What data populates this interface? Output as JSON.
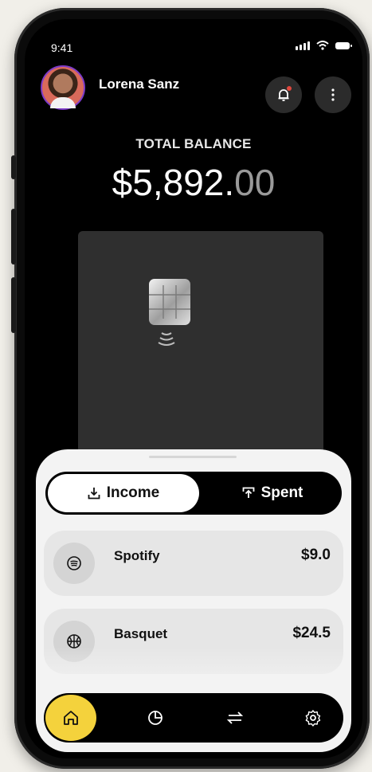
{
  "status_bar": {
    "time": "9:41"
  },
  "header": {
    "user_name": "Lorena Sanz"
  },
  "balance": {
    "label": "TOTAL BALANCE",
    "amount_main": "$5,892.",
    "amount_cents": "00"
  },
  "toggle": {
    "income_label": "Income",
    "spent_label": "Spent",
    "selected": "Income"
  },
  "transactions": [
    {
      "name": "Spotify",
      "amount": "$9.0",
      "icon": "wifi-waves-icon"
    },
    {
      "name": "Basquet",
      "amount": "$24.5",
      "icon": "basketball-icon"
    }
  ],
  "nav": {
    "items": [
      "home-icon",
      "chart-icon",
      "transfer-icon",
      "gear-icon"
    ],
    "active": "home-icon"
  },
  "colors": {
    "accent": "#f4d23c",
    "background": "#000000",
    "sheet": "#f3f3f3"
  }
}
